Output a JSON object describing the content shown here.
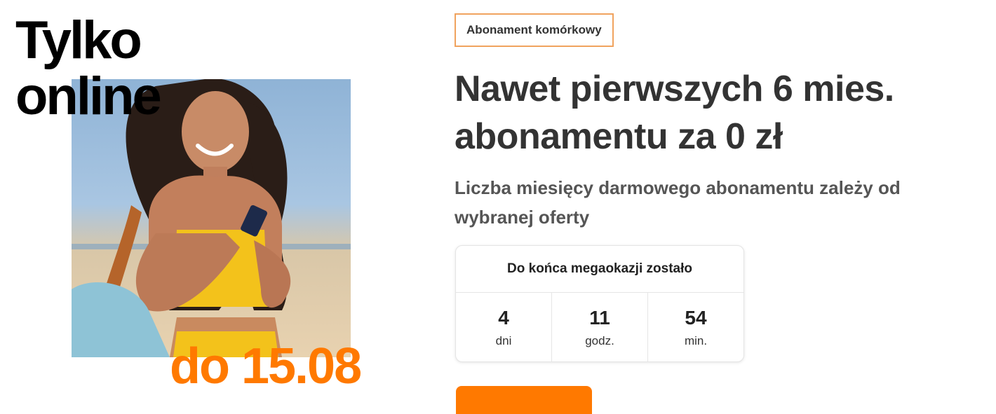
{
  "promo": {
    "headline": "Tylko\nonline",
    "date_label": "do 15.08"
  },
  "offer": {
    "badge": "Abonament komórkowy",
    "title": "Nawet pierwszych 6 mies. abonamentu za 0 zł",
    "subtitle": "Liczba miesięcy darmowego abonamentu zależy od wybranej oferty"
  },
  "countdown": {
    "title": "Do końca megaokazji zostało",
    "cells": [
      {
        "value": "4",
        "unit": "dni"
      },
      {
        "value": "11",
        "unit": "godz."
      },
      {
        "value": "54",
        "unit": "min."
      }
    ]
  },
  "colors": {
    "accent": "#ff7900",
    "badge_border": "#f0a35e"
  }
}
